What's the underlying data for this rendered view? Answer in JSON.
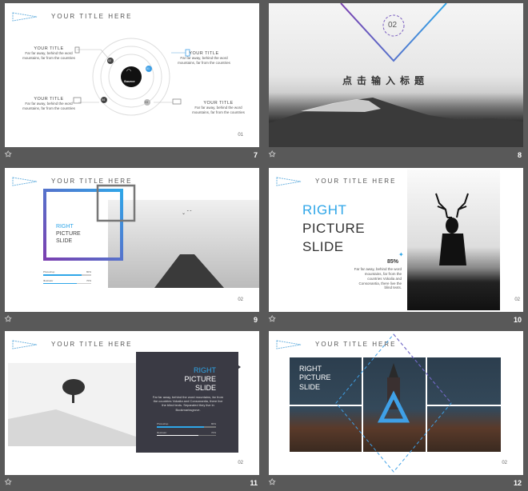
{
  "common": {
    "your_title": "YOUR TITLE HERE",
    "desc": "Far far away, behind the word mountains, far from the countries"
  },
  "slide7": {
    "center": "Source",
    "badges": [
      "01",
      "02",
      "03",
      "04"
    ],
    "title": "YOUR TITLE",
    "desc": "Far far away, behind the word mountains, far from the countries",
    "page": "01",
    "num": "7"
  },
  "slide8": {
    "badge": "02",
    "title": "点击输入标题",
    "num": "8"
  },
  "slide9": {
    "title1": "RIGHT",
    "title2": "PICTURE",
    "title3": "SLIDE",
    "bar1_label": "Photoshop",
    "bar1_val": "80%",
    "bar2_label": "Illustrator",
    "bar2_val": "70%",
    "page": "02",
    "num": "9"
  },
  "slide10": {
    "title1": "RIGHT",
    "title2": "PICTURE",
    "title3": "SLIDE",
    "percent": "85%",
    "desc": "Far far away, behind the word mountains, far from the countries Vokalia and Consonantia, there live the blind texts.",
    "page": "02",
    "num": "10"
  },
  "slide11": {
    "title1": "RIGHT",
    "title2": "PICTURE",
    "title3": "SLIDE",
    "desc": "Far far away, behind the word mountains, far from the countries Vokalia and Consonantia, there live the blind texts. Separated they live in Bookmarksgrove.",
    "bar1_label": "Photoshop",
    "bar1_val": "80%",
    "bar2_label": "Illustrator",
    "bar2_val": "70%",
    "page": "02",
    "num": "11"
  },
  "slide12": {
    "title1": "RIGHT",
    "title2": "PICTURE",
    "title3": "SLIDE",
    "page": "02",
    "num": "12"
  },
  "colors": {
    "accent": "#2fa6e8",
    "purple": "#7b3fb0",
    "dark": "#3a3a44"
  }
}
